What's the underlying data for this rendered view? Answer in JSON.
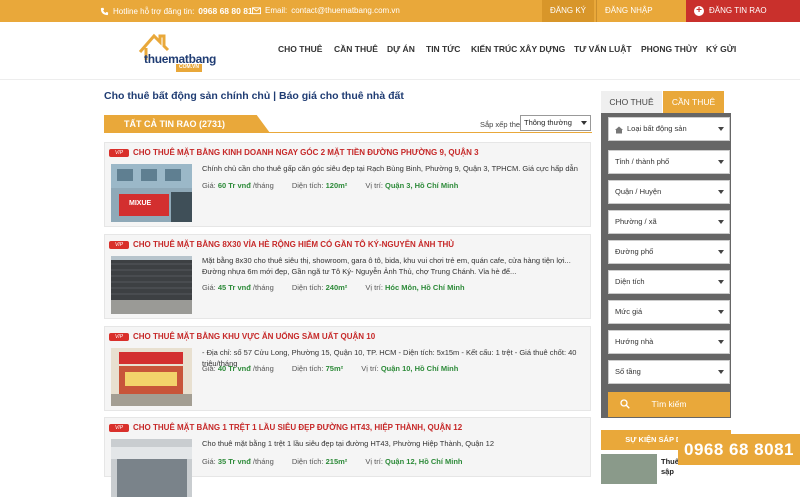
{
  "topbar": {
    "hotline_label": "Hotline hỗ trợ đăng tin:",
    "hotline_number": "0968 68 80 81",
    "email_label": "Email:",
    "email": "contact@thuematbang.com.vn",
    "register": "ĐĂNG KÝ",
    "login": "ĐĂNG NHẬP",
    "post_ad": "ĐĂNG TIN RAO"
  },
  "logo": {
    "name": "thuematbang",
    "sub": "COM.VN"
  },
  "nav": [
    "CHO THUÊ",
    "CẦN THUÊ",
    "DỰ ÁN",
    "TIN TỨC",
    "KIẾN TRÚC XÂY DỰNG",
    "TƯ VẤN LUẬT",
    "PHONG THỦY",
    "KÝ GỬI"
  ],
  "page": {
    "title": "Cho thuê bất động sản chính chủ | Báo giá cho thuê nhà đất",
    "all_tab": "TẤT CẢ TIN RAO (2731)",
    "sort_label": "Sắp xếp theo:",
    "sort_value": "Thông thường"
  },
  "listing_labels": {
    "price": "Giá:",
    "area": "Diện tích:",
    "location": "Vị trí:",
    "badge": "VIP"
  },
  "listings": [
    {
      "title": "CHO THUÊ MẶT BẰNG KINH DOANH NGAY GÓC 2 MẶT TIỀN ĐƯỜNG PHƯỜNG 9, QUẬN 3",
      "desc": "Chính chủ cần cho thuê gấp căn góc siêu đẹp tại Rạch Bùng Binh, Phường 9, Quận 3, TPHCM. Giá cực hấp dẫn",
      "price": "60 Tr vnđ",
      "price_unit": "/tháng",
      "area": "120m²",
      "location": "Quận 3, Hồ Chí Minh",
      "thumb_text": "MIXUE"
    },
    {
      "title": "CHO THUÊ MẶT BẰNG 8X30 VỈA HÈ RỘNG HIẾM CÓ GẦN TÔ KÝ-NGUYỄN ẢNH THỦ",
      "desc": "Mặt bằng 8x30 cho thuê siêu thị, showroom, gara ô tô, bida, khu vui chơi trẻ em, quán cafe, cửa hàng tiện lợi... Đường nhựa 6m mới đẹp, Gần ngã tư Tô Ký- Nguyễn Ảnh Thủ, chợ Trung Chánh. Vỉa hè để...",
      "price": "45 Tr vnđ",
      "price_unit": "/tháng",
      "area": "240m²",
      "location": "Hóc Môn, Hồ Chí Minh",
      "thumb_text": ""
    },
    {
      "title": "CHO THUÊ MẶT BẰNG KHU VỰC ĂN UỐNG SẦM UẤT QUẬN 10",
      "desc": "- Địa chỉ: số 57 Cửu Long, Phường 15, Quận 10, TP. HCM - Diện tích: 5x15m - Kết cấu: 1 trệt - Giá thuê chốt: 40 triệu/tháng",
      "price": "40 Tr vnđ",
      "price_unit": "/tháng",
      "area": "75m²",
      "location": "Quận 10, Hồ Chí Minh",
      "thumb_text": ""
    },
    {
      "title": "CHO THUÊ MẶT BẰNG 1 TRỆT 1 LẦU SIÊU ĐẸP ĐƯỜNG HT43, HIỆP THÀNH, QUẬN 12",
      "desc": "Cho thuê mặt bằng 1 trệt 1 lầu siêu đẹp tại đường HT43, Phường Hiệp Thành, Quận 12",
      "price": "35 Tr vnđ",
      "price_unit": "/tháng",
      "area": "215m²",
      "location": "Quận 12, Hồ Chí Minh",
      "thumb_text": ""
    }
  ],
  "sidebar": {
    "tab_rent": "CHO THUÊ",
    "tab_lease": "CẦN THUÊ",
    "type_select": "Loại bất động sản",
    "filters": [
      "Tỉnh / thành phố",
      "Quận / Huyện",
      "Phường / xã",
      "Đường phố",
      "Diện tích",
      "Mức giá",
      "Hướng nhà",
      "Số tầng"
    ],
    "search_button": "Tìm kiếm",
    "events_title": "SỰ KIỆN SẮP DIỄN RA",
    "event_text": "Thuê\nsập"
  },
  "hotline_badge": "0968 68 8081",
  "colors": {
    "accent": "#e9a83a",
    "title_red": "#c62828",
    "green": "#2e8b3a",
    "navy": "#1f3c73",
    "post_red": "#c9302c"
  }
}
